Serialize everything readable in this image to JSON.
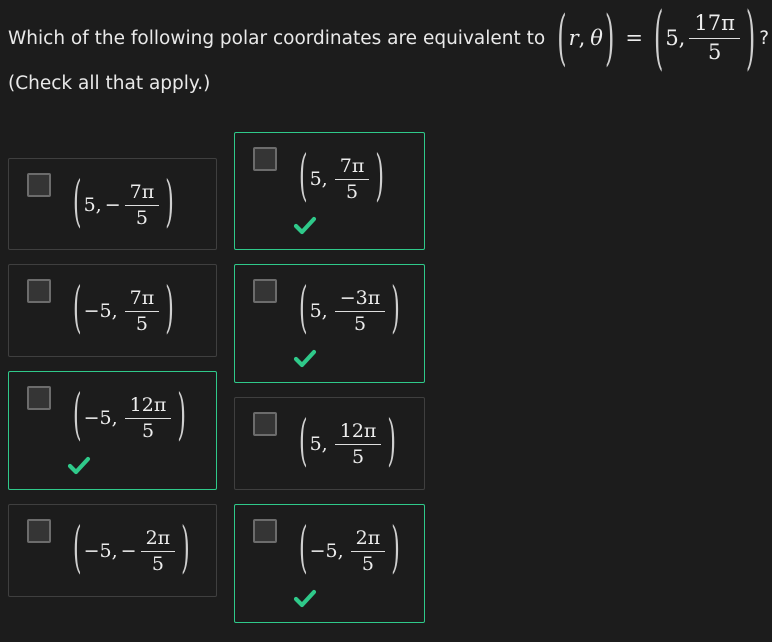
{
  "question": {
    "prefix": "Which of the following polar coordinates are equivalent to",
    "lhs_r": "r",
    "lhs_comma": ",",
    "lhs_theta": "θ",
    "equals": "=",
    "first": "5,",
    "num": "17π",
    "den": "5",
    "suffix": "?"
  },
  "instruction": "(Check all that apply.)",
  "accent_color": "#2fc98a",
  "options": [
    {
      "first": "5,",
      "sign": "−",
      "num": "7π",
      "den": "5",
      "checked": false,
      "marked_correct": false
    },
    {
      "first": "5,",
      "sign": "",
      "num": "7π",
      "den": "5",
      "checked": false,
      "marked_correct": true
    },
    {
      "first": "−5,",
      "sign": "",
      "num": "7π",
      "den": "5",
      "checked": false,
      "marked_correct": false
    },
    {
      "first": "5,",
      "sign": "",
      "num": "−3π",
      "den": "5",
      "checked": false,
      "marked_correct": true
    },
    {
      "first": "−5,",
      "sign": "",
      "num": "12π",
      "den": "5",
      "checked": false,
      "marked_correct": true
    },
    {
      "first": "5,",
      "sign": "",
      "num": "12π",
      "den": "5",
      "checked": false,
      "marked_correct": false
    },
    {
      "first": "−5,",
      "sign": "−",
      "num": "2π",
      "den": "5",
      "checked": false,
      "marked_correct": false
    },
    {
      "first": "−5,",
      "sign": "",
      "num": "2π",
      "den": "5",
      "checked": false,
      "marked_correct": true
    }
  ]
}
